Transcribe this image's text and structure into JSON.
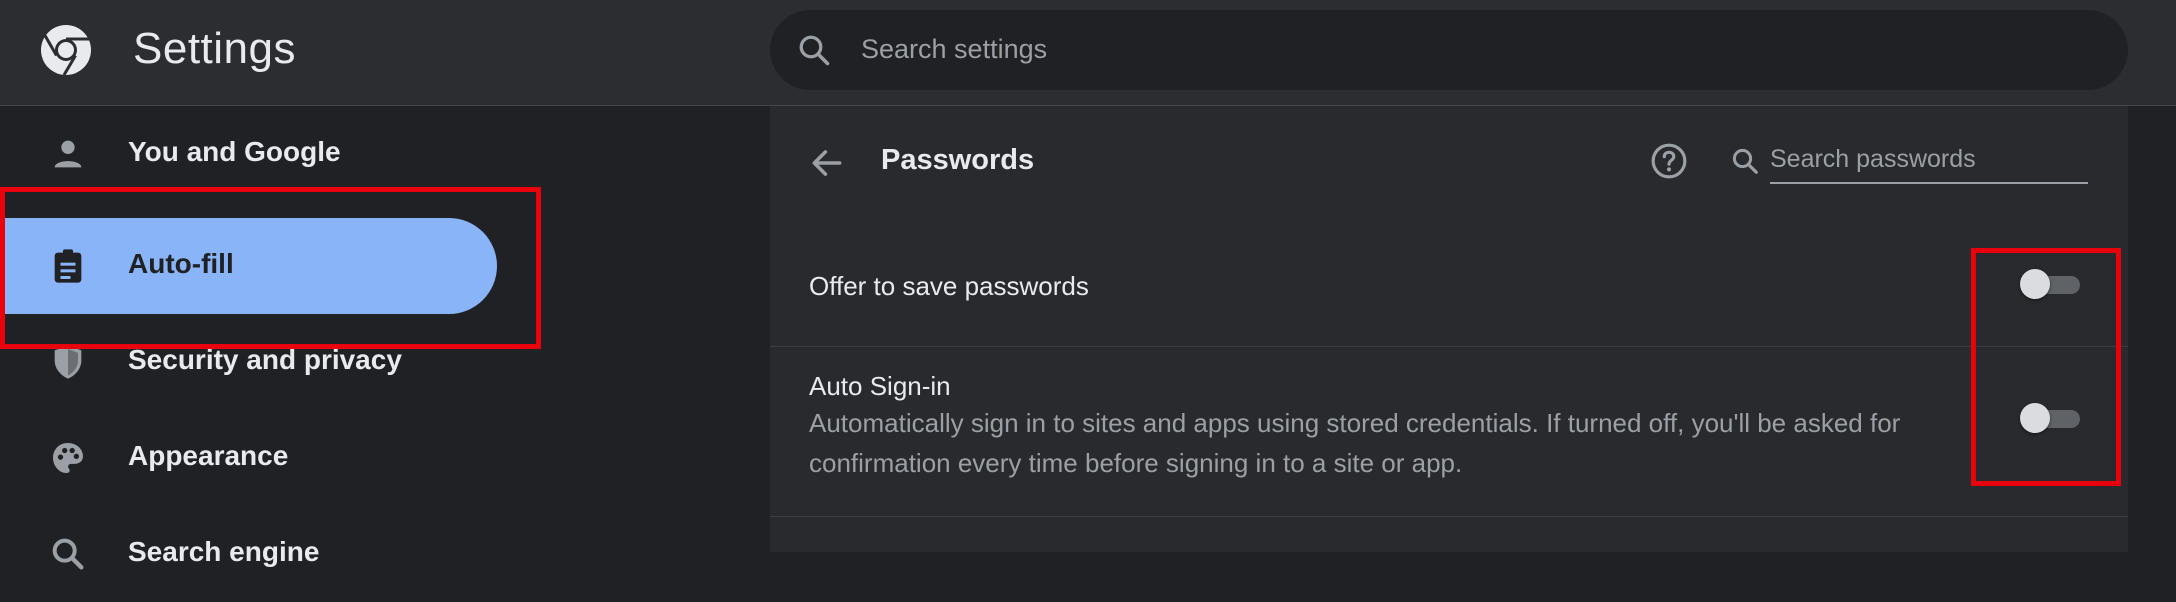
{
  "header": {
    "app_title": "Settings",
    "search_placeholder": "Search settings",
    "logo_icon": "chrome-logo-icon",
    "search_icon": "search-icon"
  },
  "sidebar": {
    "items": [
      {
        "label": "You and Google",
        "icon": "person-icon",
        "active": false
      },
      {
        "label": "Auto-fill",
        "icon": "clipboard-icon",
        "active": true
      },
      {
        "label": "Security and privacy",
        "icon": "shield-icon",
        "active": false
      },
      {
        "label": "Appearance",
        "icon": "palette-icon",
        "active": false
      },
      {
        "label": "Search engine",
        "icon": "search-icon",
        "active": false
      }
    ]
  },
  "panel": {
    "title": "Passwords",
    "back_icon": "back-arrow-icon",
    "help_icon": "help-icon",
    "search_placeholder": "Search passwords",
    "rows": [
      {
        "title": "Offer to save passwords",
        "description": "",
        "toggle_on": false
      },
      {
        "title": "Auto Sign-in",
        "description": "Automatically sign in to sites and apps using stored credentials. If turned off, you'll be asked for confirmation every time before signing in to a site or app.",
        "toggle_on": false
      }
    ]
  },
  "colors": {
    "background": "#202124",
    "topbar": "#2c2d30",
    "panel": "#292a2d",
    "accent": "#8ab4f8",
    "highlight": "#e8000b"
  }
}
